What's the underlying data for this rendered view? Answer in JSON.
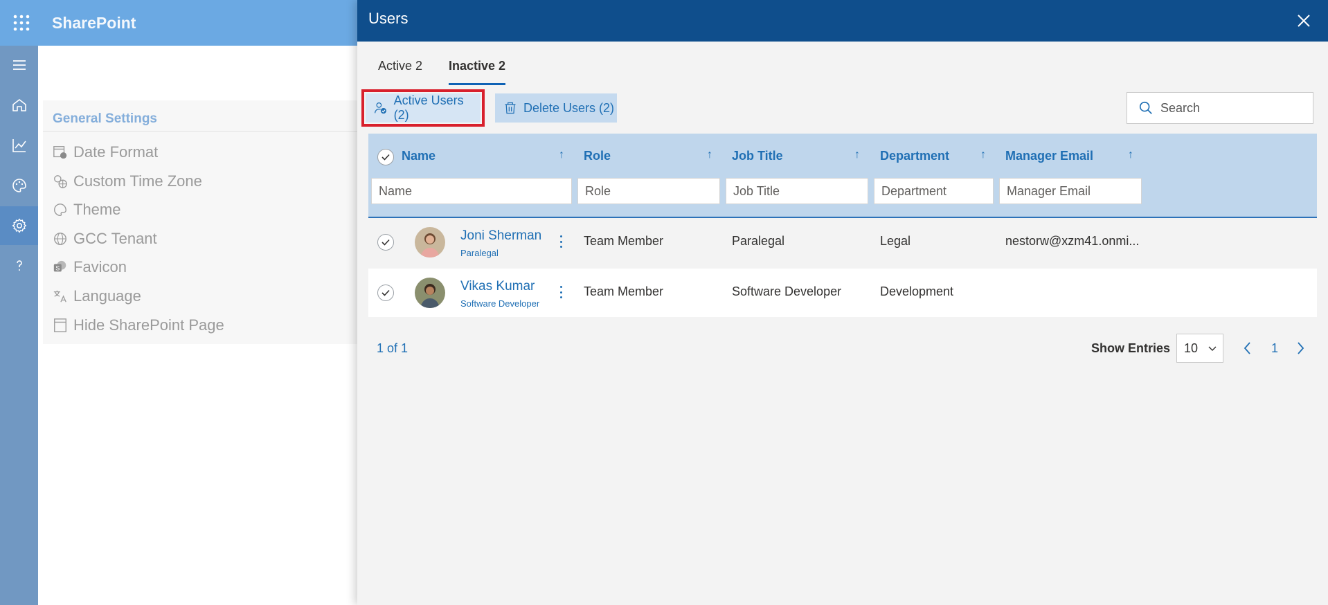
{
  "app": {
    "brand": "SharePoint",
    "settings": {
      "title": "General Settings",
      "items": [
        {
          "label": "Date Format",
          "icon": "calendar-clock-icon"
        },
        {
          "label": "Custom Time Zone",
          "icon": "globe-clock-icon"
        },
        {
          "label": "Theme",
          "icon": "palette-icon"
        },
        {
          "label": "GCC Tenant",
          "icon": "globe-icon"
        },
        {
          "label": "Favicon",
          "icon": "sharepoint-logo-icon"
        },
        {
          "label": "Language",
          "icon": "translate-icon"
        },
        {
          "label": "Hide SharePoint Page",
          "icon": "page-icon"
        }
      ]
    }
  },
  "panel": {
    "title": "Users",
    "tabs": [
      {
        "label": "Active 2",
        "active": false
      },
      {
        "label": "Inactive 2",
        "active": true
      }
    ],
    "commands": {
      "activate_label": "Active Users (2)",
      "delete_label": "Delete Users (2)"
    },
    "search": {
      "placeholder": "Search"
    },
    "columns": [
      {
        "label": "Name",
        "filter_placeholder": "Name"
      },
      {
        "label": "Role",
        "filter_placeholder": "Role"
      },
      {
        "label": "Job Title",
        "filter_placeholder": "Job Title"
      },
      {
        "label": "Department",
        "filter_placeholder": "Department"
      },
      {
        "label": "Manager Email",
        "filter_placeholder": "Manager Email"
      }
    ],
    "rows": [
      {
        "name": "Joni Sherman",
        "subtitle": "Paralegal",
        "role": "Team Member",
        "job_title": "Paralegal",
        "department": "Legal",
        "manager_email": "nestorw@xzm41.onmi...",
        "selected": true
      },
      {
        "name": "Vikas Kumar",
        "subtitle": "Software Developer",
        "role": "Team Member",
        "job_title": "Software Developer",
        "department": "Development",
        "manager_email": "",
        "selected": true
      }
    ],
    "pager": {
      "count": "1 of 1",
      "show_entries_label": "Show Entries",
      "page_size": "10",
      "current_page": "1"
    }
  },
  "colors": {
    "header_blue": "#0f4e8c",
    "accent_blue": "#1f6fb4",
    "highlight_red": "#d8202c"
  }
}
